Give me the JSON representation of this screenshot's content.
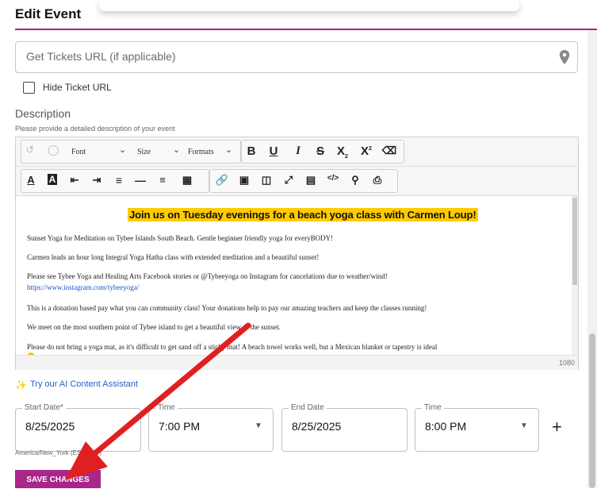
{
  "page": {
    "title": "Edit Event"
  },
  "ticket_url": {
    "placeholder": "Get Tickets URL (if applicable)",
    "value": ""
  },
  "hide_ticket": {
    "label": "Hide Ticket URL",
    "checked": false
  },
  "description": {
    "label": "Description",
    "help": "Please provide a detailed description of your event",
    "toolbar": {
      "font_label": "Font",
      "size_label": "Size",
      "formats_label": "Formats"
    },
    "headline": "Join us on Tuesday evenings for a beach yoga class with Carmen Loup!",
    "paragraphs": [
      "Sunset Yoga for Meditation on Tybee Islands South Beach. Gentle beginner friendly yoga for everyBODY!",
      "Carmen leads an hour long Integral Yoga Hatha class with extended meditation and a beautiful sunset!",
      "Please see Tybee Yoga and Healing Arts Facebook stories or @Tybeeyoga on Instagram for cancelations due to weather/wind!",
      "https://www.instagram.com/tybeeyoga/",
      "This is a donation based pay what you can community class! Your donations help to pay our amazing teachers and keep the classes running!",
      "We meet on the most southern point of Tybee island to get a beautiful view of the sunset.",
      "Please do not bring a yoga mat, as it's difficult to get sand off a sticky mat! A beach towel works well, but a Mexican blanket or tapestry is ideal"
    ],
    "char_count": "1080"
  },
  "ai_assistant": {
    "label": "Try our AI Content Assistant"
  },
  "schedule": {
    "start_date": {
      "legend": "Start Date*",
      "value": "8/25/2025"
    },
    "start_time": {
      "legend": "Time",
      "value": "7:00 PM"
    },
    "end_date": {
      "legend": "End Date",
      "value": "8/25/2025"
    },
    "end_time": {
      "legend": "Time",
      "value": "8:00 PM"
    },
    "add": "+",
    "timezone": "America/New_York (EST/EDT)"
  },
  "save_button": {
    "label": "SAVE CHANGES"
  },
  "colors": {
    "accent": "#a9268b",
    "rule": "#9c2a86",
    "highlight": "#ffcc00",
    "arrow": "#e02020",
    "link": "#1f4fd0"
  }
}
